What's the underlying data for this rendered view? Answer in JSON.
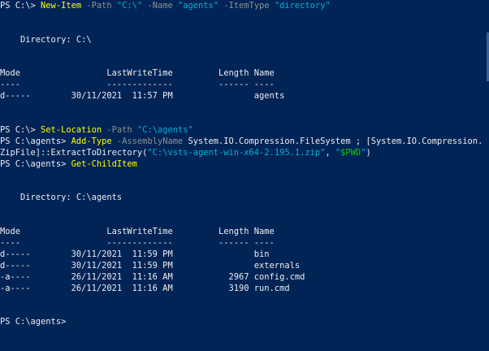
{
  "colors": {
    "background": "#012456",
    "text": "#eeedf0",
    "command": "#ffff00",
    "parameter": "#909090",
    "string": "#00b4d8",
    "variable": "#16c60c"
  },
  "lines": [
    [
      [
        "t",
        "PS C:\\> "
      ],
      [
        "c",
        "New-Item"
      ],
      [
        "t",
        " "
      ],
      [
        "p",
        "-Path"
      ],
      [
        "t",
        " "
      ],
      [
        "s",
        "\"C:\\\""
      ],
      [
        "t",
        " "
      ],
      [
        "p",
        "-Name"
      ],
      [
        "t",
        " "
      ],
      [
        "s",
        "\"agents\""
      ],
      [
        "t",
        " "
      ],
      [
        "p",
        "-ItemType"
      ],
      [
        "t",
        " "
      ],
      [
        "s",
        "\"directory\""
      ]
    ],
    [],
    [],
    [
      [
        "t",
        "    Directory: C:\\"
      ]
    ],
    [],
    [],
    [
      [
        "t",
        "Mode                 LastWriteTime         Length Name"
      ]
    ],
    [
      [
        "t",
        "----                 -------------         ------ ----"
      ]
    ],
    [
      [
        "t",
        "d-----        30/11/2021  11:57 PM                agents"
      ]
    ],
    [],
    [],
    [
      [
        "t",
        "PS C:\\> "
      ],
      [
        "c",
        "Set-Location"
      ],
      [
        "t",
        " "
      ],
      [
        "p",
        "-Path"
      ],
      [
        "t",
        " "
      ],
      [
        "s",
        "\"C:\\agents\""
      ]
    ],
    [
      [
        "t",
        "PS C:\\agents> "
      ],
      [
        "c",
        "Add-Type"
      ],
      [
        "t",
        " "
      ],
      [
        "p",
        "-AssemblyName"
      ],
      [
        "t",
        " System.IO.Compression.FileSystem ; [System.IO.Compression."
      ]
    ],
    [
      [
        "t",
        "ZipFile]::ExtractToDirectory("
      ],
      [
        "s",
        "\"C:\\vsts-agent-win-x64-2.195.1.zip\""
      ],
      [
        "t",
        ", "
      ],
      [
        "s",
        "\""
      ],
      [
        "v",
        "$PWD"
      ],
      [
        "s",
        "\""
      ],
      [
        "t",
        ")"
      ]
    ],
    [
      [
        "t",
        "PS C:\\agents> "
      ],
      [
        "c",
        "Get-ChildItem"
      ]
    ],
    [],
    [],
    [
      [
        "t",
        "    Directory: C:\\agents"
      ]
    ],
    [],
    [],
    [
      [
        "t",
        "Mode                 LastWriteTime         Length Name"
      ]
    ],
    [
      [
        "t",
        "----                 -------------         ------ ----"
      ]
    ],
    [
      [
        "t",
        "d-----        30/11/2021  11:59 PM                bin"
      ]
    ],
    [
      [
        "t",
        "d-----        30/11/2021  11:59 PM                externals"
      ]
    ],
    [
      [
        "t",
        "-a----        26/11/2021  11:16 AM           2967 config.cmd"
      ]
    ],
    [
      [
        "t",
        "-a----        26/11/2021  11:16 AM           3190 run.cmd"
      ]
    ],
    [],
    [],
    [
      [
        "t",
        "PS C:\\agents> "
      ]
    ]
  ]
}
